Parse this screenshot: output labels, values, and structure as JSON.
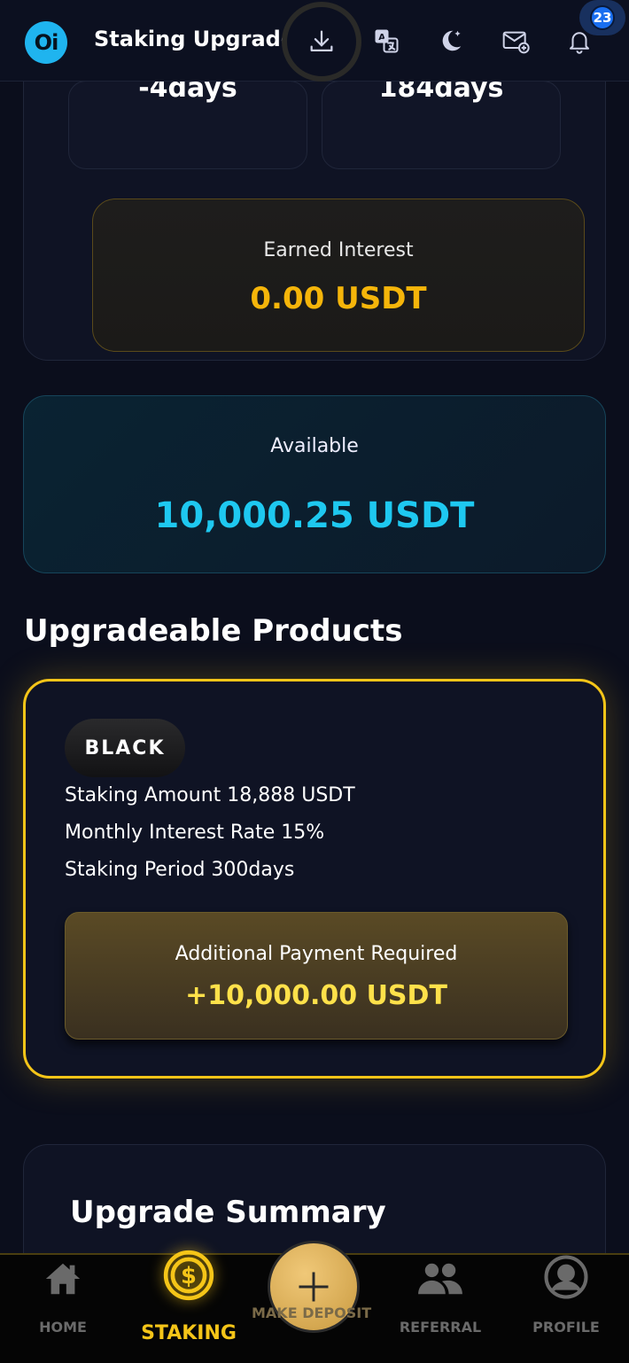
{
  "header": {
    "logo_text": "Oi",
    "title": "Staking Upgrade",
    "notification_count": "23",
    "icons": [
      "download-icon",
      "translate-icon",
      "moon-icon",
      "mail-icon",
      "bell-icon"
    ]
  },
  "current": {
    "remaining": "-4days",
    "period": "184days",
    "earned_label": "Earned Interest",
    "earned_value": "0.00 USDT"
  },
  "available": {
    "label": "Available",
    "value": "10,000.25 USDT"
  },
  "upgradeable": {
    "title": "Upgradeable Products",
    "product": {
      "tier": "BLACK",
      "amount": "Staking Amount 18,888 USDT",
      "rate": "Monthly Interest Rate 15%",
      "period": "Staking Period 300days",
      "payment_label": "Additional Payment Required",
      "payment_value": "+10,000.00 USDT"
    }
  },
  "summary": {
    "title": "Upgrade Summary"
  },
  "nav": {
    "home": "HOME",
    "staking": "STAKING",
    "deposit": "MAKE DEPOSIT",
    "referral": "REFERRAL",
    "profile": "PROFILE"
  },
  "colors": {
    "accent_gold": "#f5c518",
    "accent_cyan": "#1ec8f0",
    "interest_orange": "#f5b50a"
  }
}
